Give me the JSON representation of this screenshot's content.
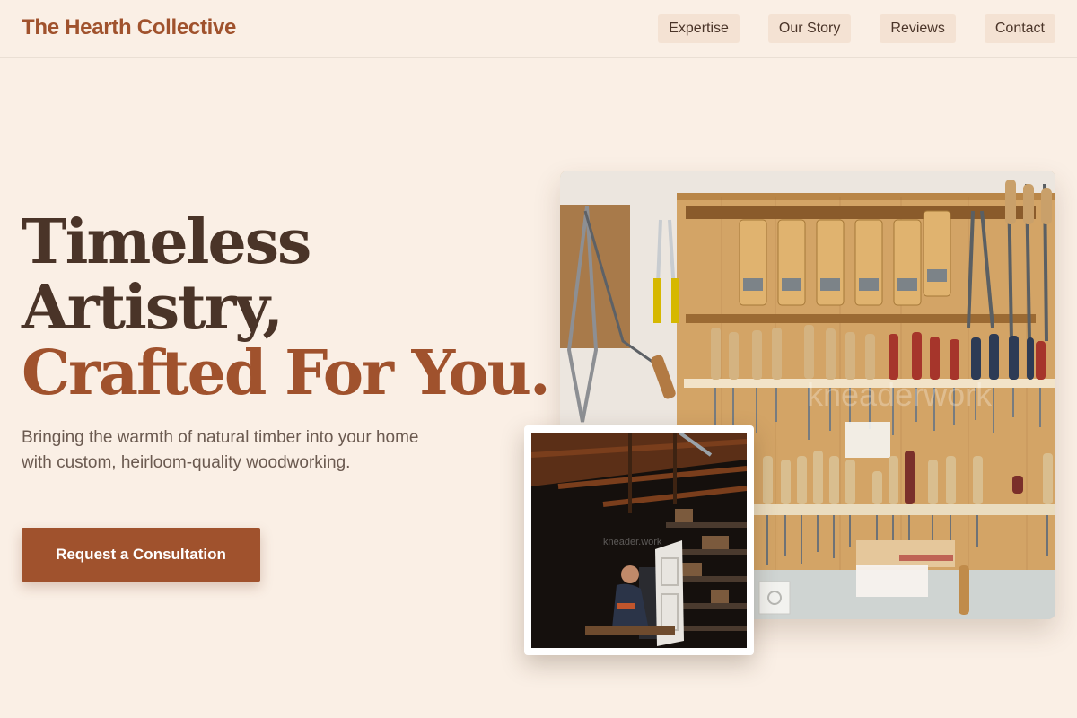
{
  "header": {
    "brand": "The Hearth Collective",
    "nav": [
      "Expertise",
      "Our Story",
      "Reviews",
      "Contact"
    ]
  },
  "hero": {
    "title_line1": "Timeless",
    "title_line2": "Artistry,",
    "title_accent": "Crafted For You.",
    "subtitle": "Bringing the warmth of natural timber into your home with custom, heirloom-quality woodworking.",
    "cta_label": "Request a Consultation"
  },
  "images": {
    "main_watermark": "kneaderwork",
    "inset_watermark": "kneader.work"
  },
  "colors": {
    "background": "#faefe5",
    "accent": "#a0522d",
    "text_dark": "#4a3428",
    "text_muted": "#6b5a50",
    "nav_bg": "#f4e2d3"
  }
}
